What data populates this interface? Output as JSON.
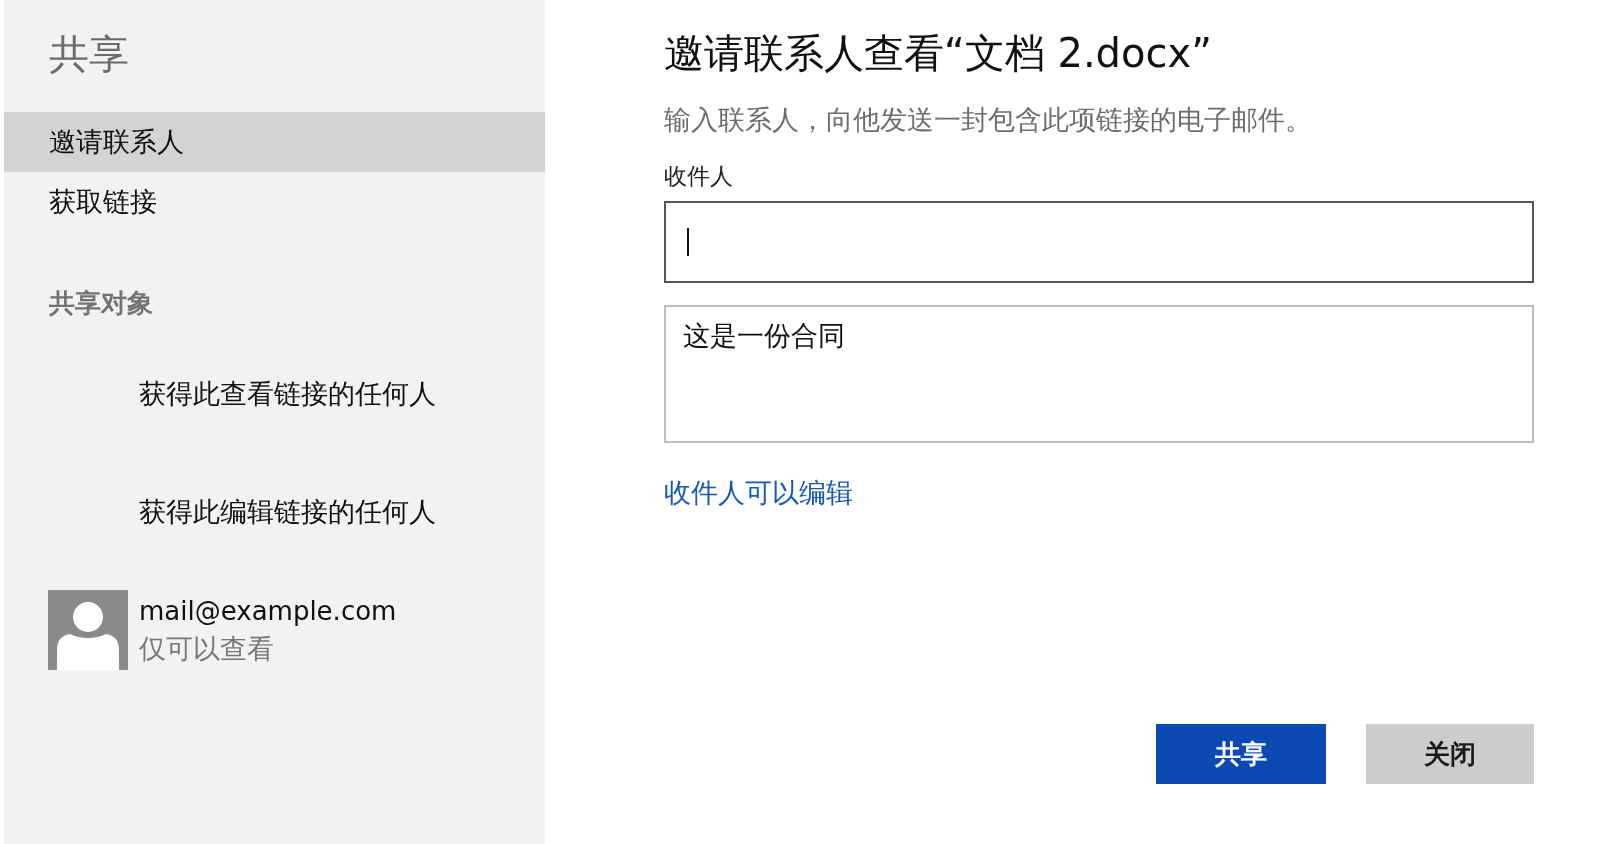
{
  "sidebar": {
    "title": "共享",
    "items": [
      {
        "label": "邀请联系人",
        "selected": true
      },
      {
        "label": "获取链接",
        "selected": false
      }
    ],
    "shared_with": {
      "heading": "共享对象",
      "entries": [
        {
          "kind": "link",
          "label": "获得此查看链接的任何人"
        },
        {
          "kind": "link",
          "label": "获得此编辑链接的任何人"
        },
        {
          "kind": "person",
          "email": "mail@example.com",
          "permission": "仅可以查看"
        }
      ]
    }
  },
  "dialog": {
    "title": "邀请联系人查看“文档 2.docx”",
    "description": "输入联系人，向他发送一封包含此项链接的电子邮件。",
    "recipients": {
      "label": "收件人",
      "focused": true
    },
    "message": {
      "value": "这是一份合同"
    },
    "permission_link": "收件人可以编辑",
    "buttons": [
      {
        "kind": "share",
        "label": "共享"
      },
      {
        "kind": "close",
        "label": "关闭"
      }
    ]
  }
}
